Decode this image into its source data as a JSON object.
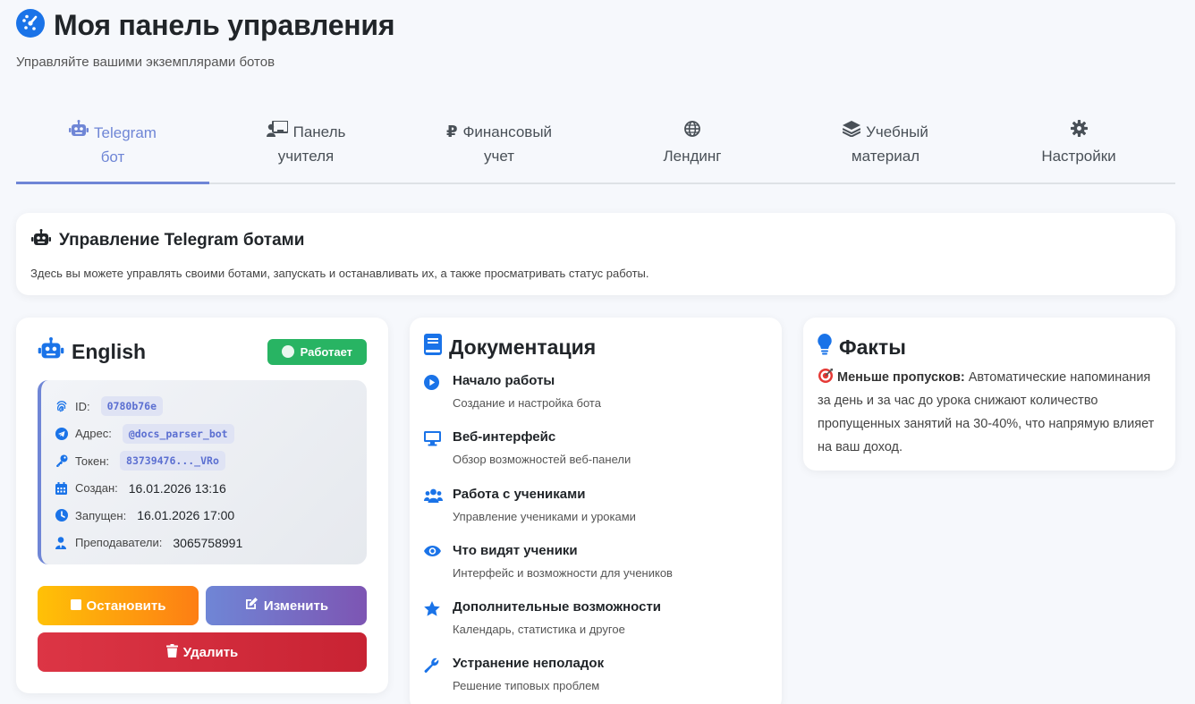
{
  "header": {
    "title": "Моя панель управления",
    "subtitle": "Управляйте вашими экземплярами ботов"
  },
  "tabs": [
    {
      "icon": "robot-icon",
      "line1": "Telegram",
      "line2": "бот",
      "active": true
    },
    {
      "icon": "teacher-board-icon",
      "line1": "Панель",
      "line2": "учителя",
      "active": false
    },
    {
      "icon": "ruble-icon",
      "line1": "Финансовый",
      "line2": "учет",
      "active": false
    },
    {
      "icon": "globe-icon",
      "line1": "",
      "line2": "Лендинг",
      "active": false
    },
    {
      "icon": "layers-icon",
      "line1": "Учебный",
      "line2": "материал",
      "active": false
    },
    {
      "icon": "gear-icon",
      "line1": "",
      "line2": "Настройки",
      "active": false
    }
  ],
  "info": {
    "title": "Управление Telegram ботами",
    "text": "Здесь вы можете управлять своими ботами, запускать и останавливать их, а также просматривать статус работы."
  },
  "bot": {
    "name": "English",
    "status": "Работает",
    "details": [
      {
        "icon": "fingerprint-icon",
        "label": "ID:",
        "value": "0780b76e",
        "code": true
      },
      {
        "icon": "telegram-icon",
        "label": "Адрес:",
        "value": "@docs_parser_bot",
        "code": true
      },
      {
        "icon": "key-icon",
        "label": "Токен:",
        "value": "83739476..._VRo",
        "code": true
      },
      {
        "icon": "calendar-icon",
        "label": "Создан:",
        "value": "16.01.2026 13:16",
        "code": false
      },
      {
        "icon": "clock-icon",
        "label": "Запущен:",
        "value": "16.01.2026 17:00",
        "code": false
      },
      {
        "icon": "teacher-icon",
        "label": "Преподаватели:",
        "value": "3065758991",
        "code": false
      }
    ],
    "stop_label": "Остановить",
    "edit_label": "Изменить",
    "delete_label": "Удалить"
  },
  "docs": {
    "title": "Документация",
    "items": [
      {
        "icon": "play-circle-icon",
        "title": "Начало работы",
        "desc": "Создание и настройка бота"
      },
      {
        "icon": "monitor-icon",
        "title": "Веб-интерфейс",
        "desc": "Обзор возможностей веб-панели"
      },
      {
        "icon": "users-icon",
        "title": "Работа с учениками",
        "desc": "Управление учениками и уроками"
      },
      {
        "icon": "eye-icon",
        "title": "Что видят ученики",
        "desc": "Интерфейс и возможности для учеников"
      },
      {
        "icon": "star-icon",
        "title": "Дополнительные возможности",
        "desc": "Календарь, статистика и другое"
      },
      {
        "icon": "wrench-icon",
        "title": "Устранение неполадок",
        "desc": "Решение типовых проблем"
      }
    ]
  },
  "facts": {
    "title": "Факты",
    "bold": "Меньше пропусков:",
    "text": " Автоматические напоминания за день и за час до урока снижают количество пропущенных занятий на 30-40%, что напрямую влияет на ваш доход."
  },
  "colors": {
    "accent": "#6f86d6",
    "icon_blue": "#1a73e8",
    "success": "#28b463",
    "danger": "#dc3545",
    "warning": "#fd7e14"
  }
}
